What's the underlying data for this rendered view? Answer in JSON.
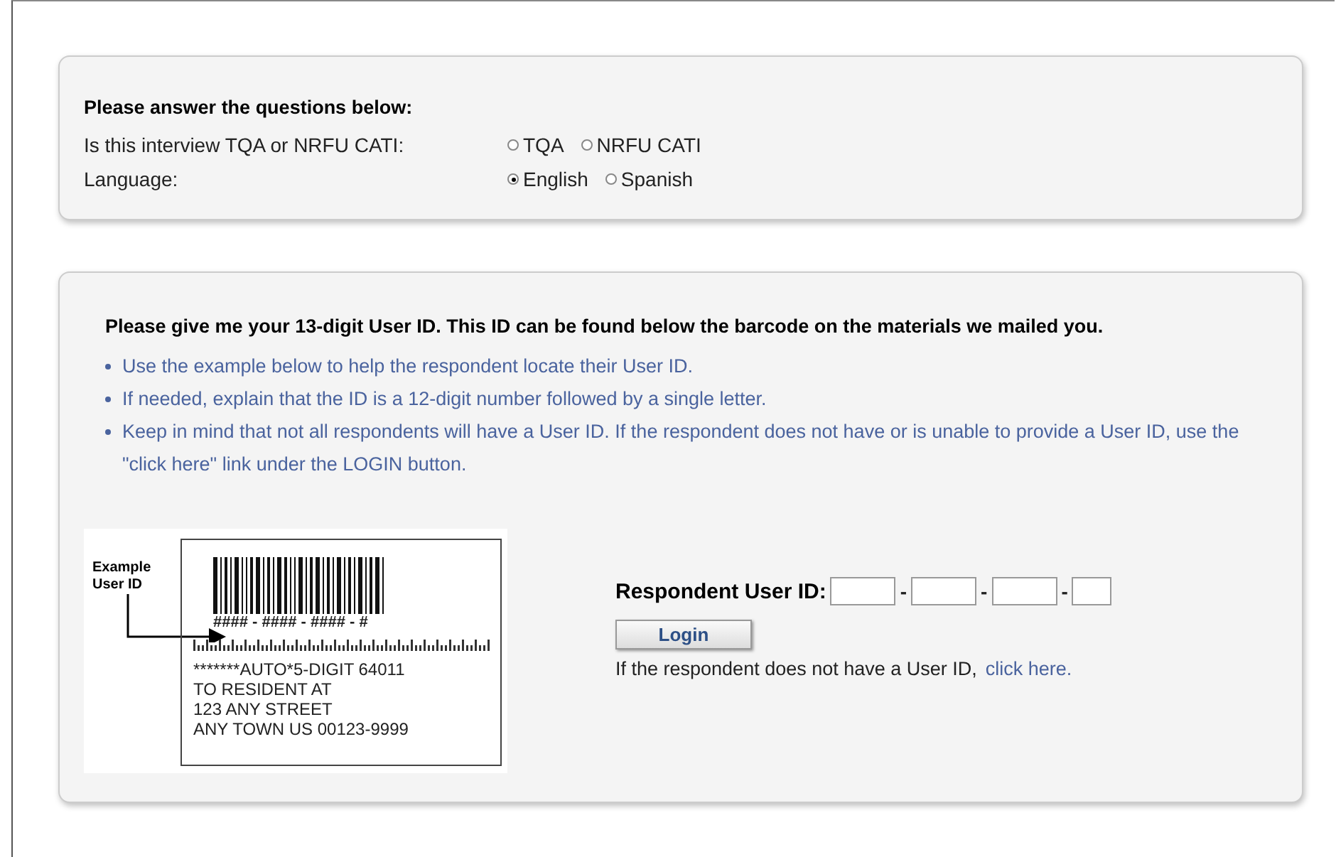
{
  "questions": {
    "heading": "Please answer the questions below:",
    "rows": [
      {
        "label": "Is this interview TQA or NRFU CATI:",
        "options": [
          {
            "label": "TQA",
            "selected": false
          },
          {
            "label": "NRFU CATI",
            "selected": false
          }
        ]
      },
      {
        "label": "Language:",
        "options": [
          {
            "label": "English",
            "selected": true
          },
          {
            "label": "Spanish",
            "selected": false
          }
        ]
      }
    ]
  },
  "user_id": {
    "heading": "Please give me your 13-digit User ID. This ID can be found below the barcode on the materials we mailed you.",
    "tips": [
      "Use the example below to help the respondent locate their User ID.",
      "If needed, explain that the ID is a 12-digit number followed by a single letter.",
      "Keep in mind that not all respondents will have a User ID. If the respondent does not have or is unable to provide a User ID, use the \"click here\" link under the LOGIN button."
    ],
    "example": {
      "caption_lines": [
        "Example",
        "User ID"
      ],
      "id_pattern": "#### - #### - #### - #",
      "address_lines": [
        "*******AUTO*5-DIGIT 64011",
        "TO RESIDENT AT",
        "123 ANY STREET",
        "ANY TOWN US 00123-9999"
      ]
    },
    "field_label": "Respondent User ID:",
    "separator": "-",
    "login_button": "Login",
    "no_id_text": "If the respondent does not have a User ID,",
    "no_id_link": "click here."
  }
}
